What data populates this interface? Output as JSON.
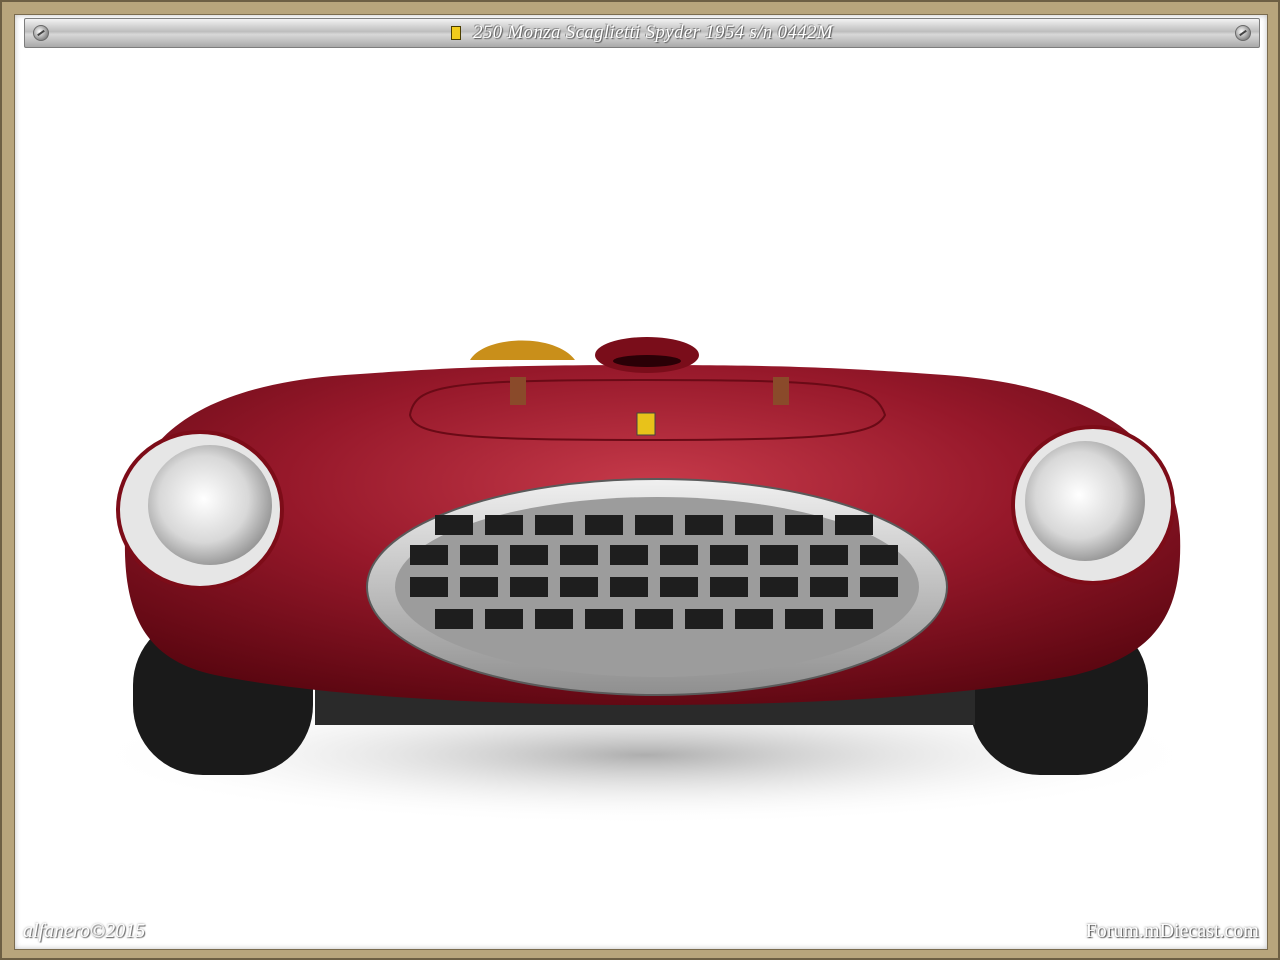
{
  "title": "250 Monza Scaglietti Spyder 1954  s/n 0442M",
  "signature": "alfanero©2015",
  "watermark": "Forum.mDiecast.com",
  "colors": {
    "body": "#8b1220",
    "frame": "#b8a57c",
    "grille": "#c4c4c4"
  }
}
